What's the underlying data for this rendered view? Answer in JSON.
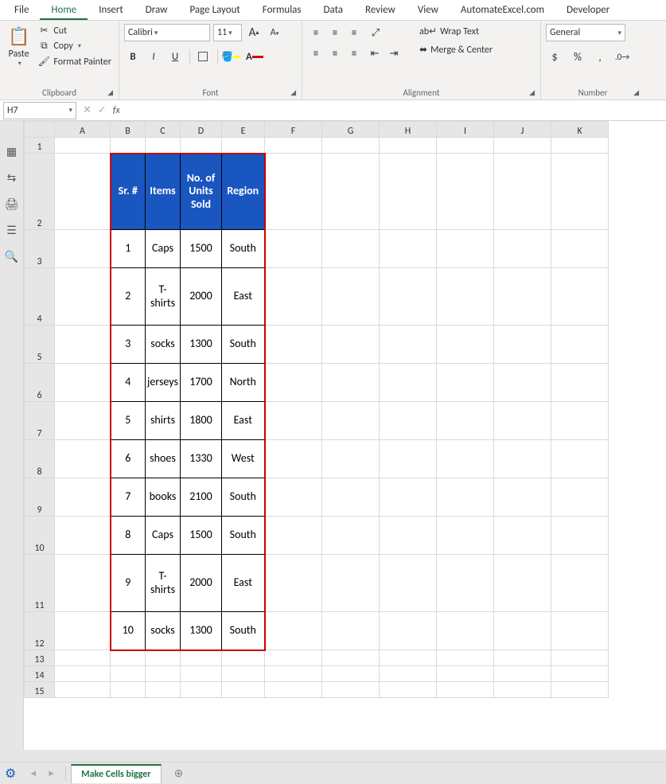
{
  "tabs": [
    "File",
    "Home",
    "Insert",
    "Draw",
    "Page Layout",
    "Formulas",
    "Data",
    "Review",
    "View",
    "AutomateExcel.com",
    "Developer"
  ],
  "active_tab": "Home",
  "clipboard": {
    "paste": "Paste",
    "cut": "Cut",
    "copy": "Copy",
    "format_painter": "Format Painter",
    "label": "Clipboard"
  },
  "font": {
    "name": "Calibri",
    "size": "11",
    "bold": "B",
    "italic": "I",
    "underline": "U",
    "label": "Font",
    "grow": "A",
    "shrink": "A"
  },
  "alignment": {
    "wrap": "Wrap Text",
    "merge": "Merge & Center",
    "label": "Alignment"
  },
  "number": {
    "format": "General",
    "currency": "$",
    "percent": "%",
    "comma": ",",
    "label": "Number"
  },
  "name_box": "H7",
  "formula_value": "",
  "fx_label": "fx",
  "columns": [
    "A",
    "B",
    "C",
    "D",
    "E",
    "F",
    "G",
    "H",
    "I",
    "J",
    "K"
  ],
  "rownums": [
    "1",
    "2",
    "3",
    "4",
    "5",
    "6",
    "7",
    "8",
    "9",
    "10",
    "11",
    "12",
    "13",
    "14",
    "15"
  ],
  "headers": {
    "sr": "Sr. #",
    "items": "Items",
    "units": "No. of Units Sold",
    "region": "Region"
  },
  "rows": [
    {
      "sr": "1",
      "item": "Caps",
      "units": "1500",
      "region": "South"
    },
    {
      "sr": "2",
      "item": "T-shirts",
      "units": "2000",
      "region": "East"
    },
    {
      "sr": "3",
      "item": "socks",
      "units": "1300",
      "region": "South"
    },
    {
      "sr": "4",
      "item": "jerseys",
      "units": "1700",
      "region": "North"
    },
    {
      "sr": "5",
      "item": "shirts",
      "units": "1800",
      "region": "East"
    },
    {
      "sr": "6",
      "item": "shoes",
      "units": "1330",
      "region": "West"
    },
    {
      "sr": "7",
      "item": "books",
      "units": "2100",
      "region": "South"
    },
    {
      "sr": "8",
      "item": "Caps",
      "units": "1500",
      "region": "South"
    },
    {
      "sr": "9",
      "item": "T-shirts",
      "units": "2000",
      "region": "East"
    },
    {
      "sr": "10",
      "item": "socks",
      "units": "1300",
      "region": "South"
    }
  ],
  "sheet_tab": "Make Cells bigger"
}
